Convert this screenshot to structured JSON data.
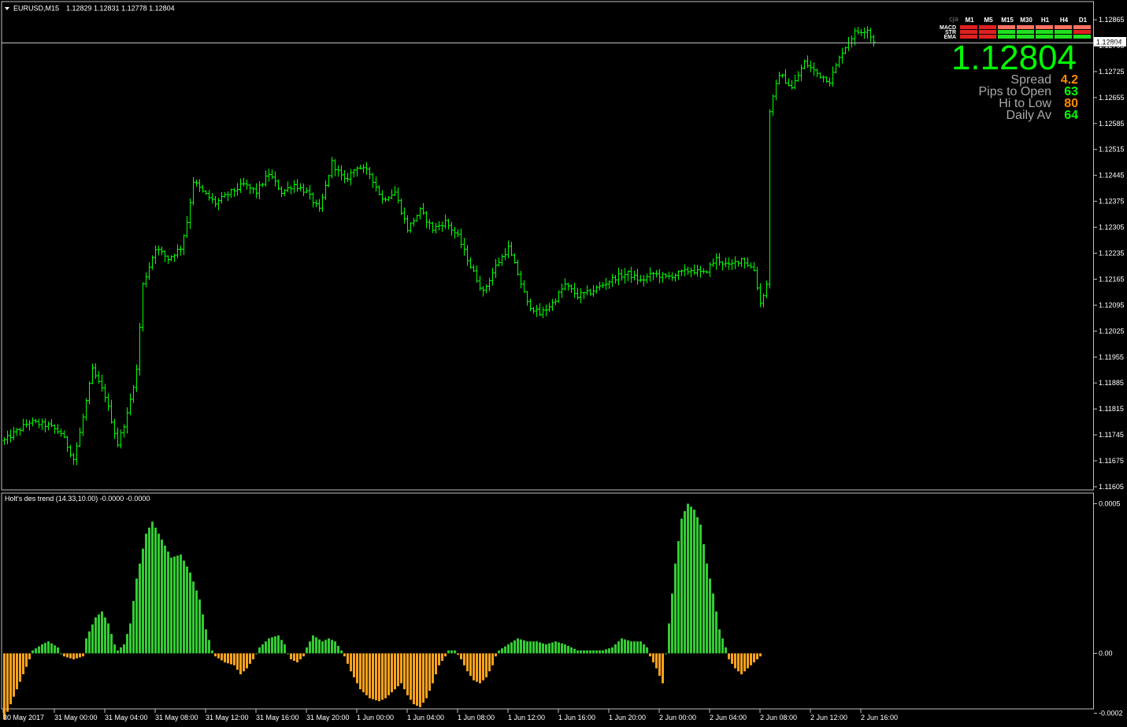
{
  "header": {
    "symbol_text": "EURUSD,M15",
    "ohlc_text": "1.12829 1.12831 1.12778 1.12804"
  },
  "price_panel": {
    "current_price": "1.12804",
    "current_price_label": "1.12804",
    "y_ticks": [
      "1.12865",
      "1.12795",
      "1.12725",
      "1.12655",
      "1.12585",
      "1.12515",
      "1.12445",
      "1.12375",
      "1.12305",
      "1.12235",
      "1.12165",
      "1.12095",
      "1.12025",
      "1.11955",
      "1.11885",
      "1.11815",
      "1.11745",
      "1.11675",
      "1.11605"
    ],
    "bar_color": "#00ff00"
  },
  "info_panel": {
    "stats": [
      {
        "label": "Spread",
        "value": "4.2",
        "color": "#ff8c00"
      },
      {
        "label": "Pips to Open",
        "value": "63",
        "color": "#00ff00"
      },
      {
        "label": "Hi to Low",
        "value": "80",
        "color": "#ff8c00"
      },
      {
        "label": "Daily Av",
        "value": "64",
        "color": "#00ff00"
      }
    ]
  },
  "signal_table": {
    "corner": "cja",
    "timeframes": [
      "M1",
      "M5",
      "M15",
      "M30",
      "H1",
      "H4",
      "D1"
    ],
    "rows": [
      {
        "name": "MACD",
        "colors": [
          "#e02020",
          "#e02020",
          "#ff7060",
          "#ff7060",
          "#ff7060",
          "#ff7060",
          "#ff7060"
        ]
      },
      {
        "name": "STR",
        "colors": [
          "#e02020",
          "#e02020",
          "#20e020",
          "#20e020",
          "#20e020",
          "#20e020",
          "#e02020"
        ]
      },
      {
        "name": "EMA",
        "colors": [
          "#e02020",
          "#e02020",
          "#20e020",
          "#20e020",
          "#20e020",
          "#20e020",
          "#20e020"
        ]
      }
    ]
  },
  "indicator_panel": {
    "title": "Holt's des trend (14.33,10.00) -0.0000 -0.0000",
    "y_ticks": [
      "0.0005",
      "0.00",
      "-0.0002"
    ],
    "positive_color": "#33cc33",
    "negative_color": "#ffa31a"
  },
  "time_axis": {
    "labels": [
      "30 May 2017",
      "31 May 00:00",
      "31 May 04:00",
      "31 May 08:00",
      "31 May 12:00",
      "31 May 16:00",
      "31 May 20:00",
      "1 Jun 00:00",
      "1 Jun 04:00",
      "1 Jun 08:00",
      "1 Jun 12:00",
      "1 Jun 16:00",
      "1 Jun 20:00",
      "2 Jun 00:00",
      "2 Jun 04:00",
      "2 Jun 08:00",
      "2 Jun 12:00",
      "2 Jun 16:00"
    ]
  },
  "chart_data": [
    {
      "type": "ohlc",
      "title": "EURUSD,M15",
      "ylim": [
        1.11605,
        1.12865
      ],
      "bar_interval": "15 min",
      "close_keyframes": [
        [
          0,
          1.1173
        ],
        [
          8,
          1.1178
        ],
        [
          14,
          1.1177
        ],
        [
          18,
          1.1175
        ],
        [
          22,
          1.1168
        ],
        [
          24,
          1.1175
        ],
        [
          28,
          1.1192
        ],
        [
          32,
          1.1185
        ],
        [
          36,
          1.1172
        ],
        [
          39,
          1.118
        ],
        [
          42,
          1.1192
        ],
        [
          44,
          1.1215
        ],
        [
          48,
          1.1225
        ],
        [
          52,
          1.1222
        ],
        [
          56,
          1.1225
        ],
        [
          58,
          1.1232
        ],
        [
          60,
          1.1243
        ],
        [
          63,
          1.124
        ],
        [
          67,
          1.1237
        ],
        [
          72,
          1.124
        ],
        [
          76,
          1.1242
        ],
        [
          80,
          1.124
        ],
        [
          84,
          1.1245
        ],
        [
          88,
          1.124
        ],
        [
          92,
          1.1242
        ],
        [
          96,
          1.124
        ],
        [
          100,
          1.1235
        ],
        [
          104,
          1.1248
        ],
        [
          108,
          1.1243
        ],
        [
          112,
          1.1247
        ],
        [
          116,
          1.1245
        ],
        [
          120,
          1.1238
        ],
        [
          124,
          1.124
        ],
        [
          128,
          1.123
        ],
        [
          132,
          1.1235
        ],
        [
          136,
          1.123
        ],
        [
          140,
          1.1232
        ],
        [
          144,
          1.1228
        ],
        [
          148,
          1.122
        ],
        [
          152,
          1.1213
        ],
        [
          156,
          1.122
        ],
        [
          160,
          1.1225
        ],
        [
          163,
          1.1218
        ],
        [
          166,
          1.121
        ],
        [
          170,
          1.1207
        ],
        [
          174,
          1.121
        ],
        [
          178,
          1.1215
        ],
        [
          182,
          1.1212
        ],
        [
          186,
          1.1213
        ],
        [
          190,
          1.1215
        ],
        [
          194,
          1.1217
        ],
        [
          198,
          1.1218
        ],
        [
          202,
          1.1216
        ],
        [
          206,
          1.1218
        ],
        [
          210,
          1.1217
        ],
        [
          214,
          1.1218
        ],
        [
          218,
          1.1219
        ],
        [
          222,
          1.1218
        ],
        [
          226,
          1.1222
        ],
        [
          230,
          1.122
        ],
        [
          234,
          1.1222
        ],
        [
          238,
          1.1219
        ],
        [
          240,
          1.121
        ],
        [
          242,
          1.1215
        ],
        [
          243,
          1.1262
        ],
        [
          246,
          1.1272
        ],
        [
          250,
          1.1268
        ],
        [
          254,
          1.1275
        ],
        [
          258,
          1.1272
        ],
        [
          262,
          1.127
        ],
        [
          266,
          1.1278
        ],
        [
          270,
          1.1283
        ],
        [
          274,
          1.1284
        ],
        [
          276,
          1.128
        ]
      ]
    },
    {
      "type": "bar",
      "title": "Holt's des trend (14.33,10.00)",
      "ylim": [
        -0.0002,
        0.0005
      ],
      "keyframes": [
        [
          0,
          -0.00022
        ],
        [
          4,
          -0.00012
        ],
        [
          8,
          -2e-05
        ],
        [
          9,
          1e-05
        ],
        [
          12,
          3e-05
        ],
        [
          14,
          4e-05
        ],
        [
          17,
          2e-05
        ],
        [
          18,
          0.0
        ],
        [
          19,
          -1e-05
        ],
        [
          22,
          -2e-05
        ],
        [
          25,
          -1e-05
        ],
        [
          26,
          5e-05
        ],
        [
          29,
          0.00012
        ],
        [
          31,
          0.00014
        ],
        [
          33,
          0.0001
        ],
        [
          35,
          3e-05
        ],
        [
          36,
          1e-05
        ],
        [
          38,
          3e-05
        ],
        [
          40,
          0.0001
        ],
        [
          42,
          0.00025
        ],
        [
          45,
          0.0004
        ],
        [
          47,
          0.00044
        ],
        [
          50,
          0.00038
        ],
        [
          53,
          0.00032
        ],
        [
          56,
          0.00033
        ],
        [
          59,
          0.00027
        ],
        [
          62,
          0.00018
        ],
        [
          64,
          8e-05
        ],
        [
          66,
          1e-05
        ],
        [
          67,
          -1e-05
        ],
        [
          70,
          -3e-05
        ],
        [
          73,
          -4e-05
        ],
        [
          75,
          -7e-05
        ],
        [
          77,
          -5e-05
        ],
        [
          79,
          -2e-05
        ],
        [
          80,
          0.0
        ],
        [
          81,
          2e-05
        ],
        [
          84,
          5e-05
        ],
        [
          87,
          6e-05
        ],
        [
          89,
          3e-05
        ],
        [
          90,
          0.0
        ],
        [
          91,
          -2e-05
        ],
        [
          93,
          -3e-05
        ],
        [
          95,
          -1e-05
        ],
        [
          96,
          2e-05
        ],
        [
          98,
          6e-05
        ],
        [
          101,
          4e-05
        ],
        [
          103,
          5e-05
        ],
        [
          105,
          4e-05
        ],
        [
          107,
          1e-05
        ],
        [
          108,
          -1e-05
        ],
        [
          110,
          -6e-05
        ],
        [
          113,
          -0.00012
        ],
        [
          116,
          -0.00015
        ],
        [
          119,
          -0.00016
        ],
        [
          121,
          -0.00015
        ],
        [
          124,
          -0.00012
        ],
        [
          126,
          -0.0001
        ],
        [
          128,
          -0.00014
        ],
        [
          130,
          -0.00017
        ],
        [
          132,
          -0.00018
        ],
        [
          134,
          -0.00015
        ],
        [
          136,
          -0.0001
        ],
        [
          138,
          -4e-05
        ],
        [
          140,
          -1e-05
        ],
        [
          141,
          1e-05
        ],
        [
          143,
          1e-05
        ],
        [
          145,
          -2e-05
        ],
        [
          147,
          -6e-05
        ],
        [
          149,
          -9e-05
        ],
        [
          151,
          -0.0001
        ],
        [
          153,
          -8e-05
        ],
        [
          155,
          -4e-05
        ],
        [
          156,
          -1e-05
        ],
        [
          157,
          1e-05
        ],
        [
          160,
          3e-05
        ],
        [
          163,
          5e-05
        ],
        [
          166,
          4e-05
        ],
        [
          169,
          4e-05
        ],
        [
          172,
          3e-05
        ],
        [
          175,
          4e-05
        ],
        [
          178,
          3e-05
        ],
        [
          180,
          2e-05
        ],
        [
          182,
          1e-05
        ],
        [
          186,
          1e-05
        ],
        [
          190,
          1e-05
        ],
        [
          193,
          2e-05
        ],
        [
          196,
          5e-05
        ],
        [
          199,
          4e-05
        ],
        [
          202,
          4e-05
        ],
        [
          204,
          2e-05
        ],
        [
          205,
          -1e-05
        ],
        [
          207,
          -5e-05
        ],
        [
          209,
          -0.0001
        ],
        [
          211,
          0.0001
        ],
        [
          213,
          0.0003
        ],
        [
          215,
          0.00045
        ],
        [
          217,
          0.0005
        ],
        [
          219,
          0.00048
        ],
        [
          221,
          0.00043
        ],
        [
          223,
          0.0003
        ],
        [
          225,
          0.0002
        ],
        [
          227,
          8e-05
        ],
        [
          229,
          2e-05
        ],
        [
          230,
          -2e-05
        ],
        [
          232,
          -5e-05
        ],
        [
          234,
          -7e-05
        ],
        [
          236,
          -5e-05
        ],
        [
          238,
          -3e-05
        ],
        [
          240,
          -1e-05
        ]
      ]
    }
  ]
}
